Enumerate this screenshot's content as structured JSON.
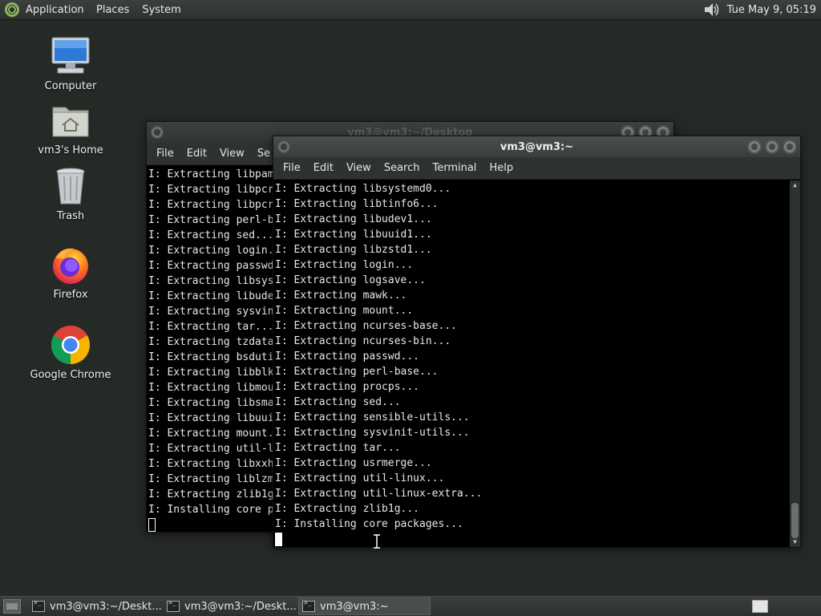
{
  "top_panel": {
    "menus": [
      "Applications",
      "Places",
      "System"
    ],
    "clock": "Tue May 9, 05:19",
    "icons": {
      "apps": "mate-logo-icon",
      "volume": "speaker-icon"
    }
  },
  "desktop_icons": [
    {
      "label": "Computer",
      "icon": "computer-icon"
    },
    {
      "label": "vm3's Home",
      "icon": "home-folder-icon"
    },
    {
      "label": "Trash",
      "icon": "trash-icon"
    },
    {
      "label": "Firefox",
      "icon": "firefox-icon"
    },
    {
      "label": "Google Chrome",
      "icon": "chrome-icon"
    }
  ],
  "back_window": {
    "title": "vm3@vm3:~/Desktop",
    "menus": [
      "File",
      "Edit",
      "View",
      "Se"
    ],
    "lines": [
      "I: Extracting libpam",
      "I: Extracting libpcr",
      "I: Extracting libpcr",
      "I: Extracting perl-b",
      "I: Extracting sed...",
      "I: Extracting login.",
      "I: Extracting passwd",
      "I: Extracting libsys",
      "I: Extracting libude",
      "I: Extracting sysvin",
      "I: Extracting tar...",
      "I: Extracting tzdata",
      "I: Extracting bsduti",
      "I: Extracting libblk",
      "I: Extracting libmou",
      "I: Extracting libsma",
      "I: Extracting libuui",
      "I: Extracting mount.",
      "I: Extracting util-l",
      "I: Extracting libxxh",
      "I: Extracting liblzm",
      "I: Extracting zlib1g",
      "I: Installing core p"
    ]
  },
  "front_window": {
    "title": "vm3@vm3:~",
    "menus": [
      "File",
      "Edit",
      "View",
      "Search",
      "Terminal",
      "Help"
    ],
    "lines": [
      "I: Extracting libsystemd0...",
      "I: Extracting libtinfo6...",
      "I: Extracting libudev1...",
      "I: Extracting libuuid1...",
      "I: Extracting libzstd1...",
      "I: Extracting login...",
      "I: Extracting logsave...",
      "I: Extracting mawk...",
      "I: Extracting mount...",
      "I: Extracting ncurses-base...",
      "I: Extracting ncurses-bin...",
      "I: Extracting passwd...",
      "I: Extracting perl-base...",
      "I: Extracting procps...",
      "I: Extracting sed...",
      "I: Extracting sensible-utils...",
      "I: Extracting sysvinit-utils...",
      "I: Extracting tar...",
      "I: Extracting usrmerge...",
      "I: Extracting util-linux...",
      "I: Extracting util-linux-extra...",
      "I: Extracting zlib1g...",
      "I: Installing core packages..."
    ]
  },
  "taskbar": {
    "tasks": [
      {
        "label": "vm3@vm3:~/Deskt...",
        "active": false
      },
      {
        "label": "vm3@vm3:~/Deskt...",
        "active": false
      },
      {
        "label": "vm3@vm3:~",
        "active": true
      }
    ]
  }
}
